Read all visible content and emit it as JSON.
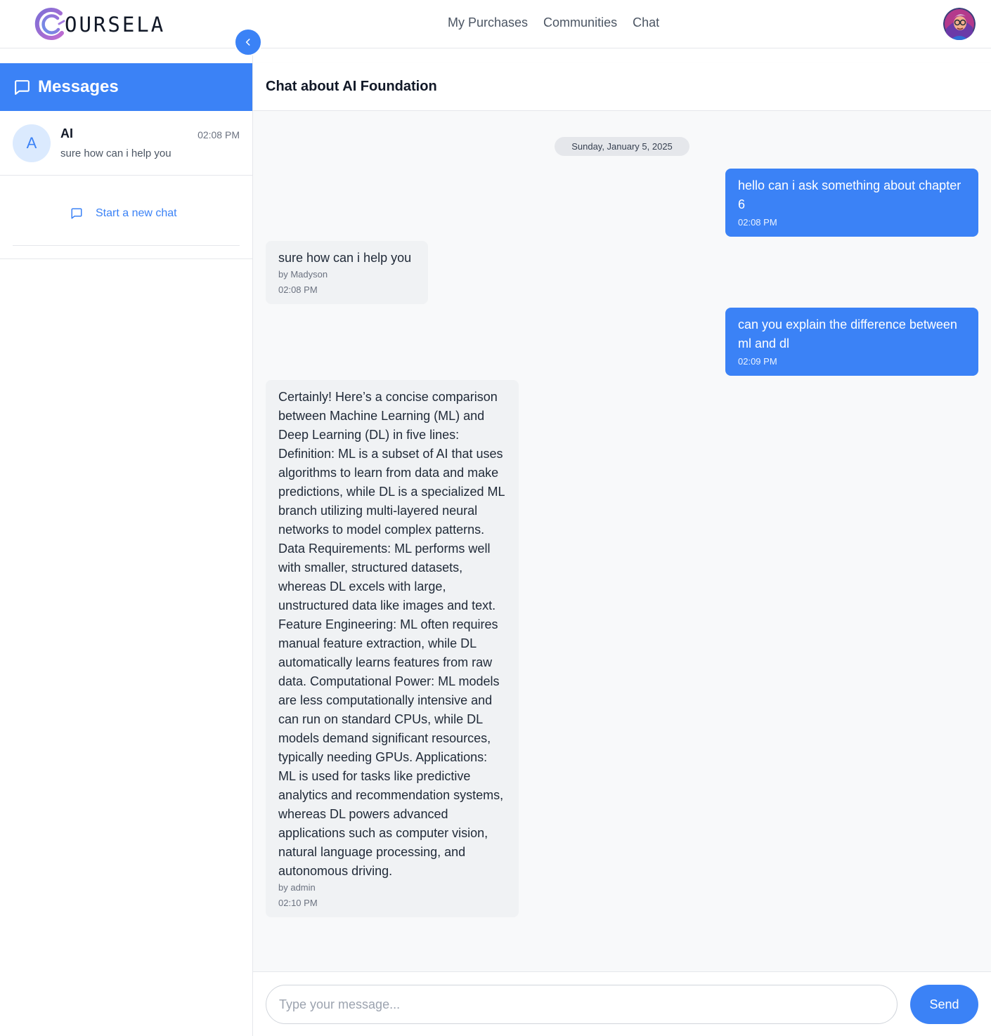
{
  "brand": {
    "name": "OURSELA"
  },
  "nav": {
    "links": [
      {
        "label": "My Purchases"
      },
      {
        "label": "Communities"
      },
      {
        "label": "Chat"
      }
    ]
  },
  "sidebar": {
    "title": "Messages",
    "conversations": [
      {
        "avatar_letter": "A",
        "name": "AI",
        "time": "02:08 PM",
        "preview": "sure how can i help you"
      }
    ],
    "new_chat_label": "Start a new chat"
  },
  "chat": {
    "title": "Chat about AI Foundation",
    "date_divider": "Sunday, January 5, 2025",
    "messages": [
      {
        "direction": "outgoing",
        "text": "hello can i ask something about chapter 6",
        "time": "02:08 PM"
      },
      {
        "direction": "incoming",
        "text": "sure how can i help you",
        "author": "by Madyson",
        "time": "02:08 PM"
      },
      {
        "direction": "outgoing",
        "text": "can you explain the difference between ml and dl",
        "time": "02:09 PM"
      },
      {
        "direction": "incoming",
        "text": "Certainly! Here’s a concise comparison between Machine Learning (ML) and Deep Learning (DL) in five lines: Definition: ML is a subset of AI that uses algorithms to learn from data and make predictions, while DL is a specialized ML branch utilizing multi-layered neural networks to model complex patterns. Data Requirements: ML performs well with smaller, structured datasets, whereas DL excels with large, unstructured data like images and text. Feature Engineering: ML often requires manual feature extraction, while DL automatically learns features from raw data. Computational Power: ML models are less computationally intensive and can run on standard CPUs, while DL models demand significant resources, typically needing GPUs. Applications: ML is used for tasks like predictive analytics and recommendation systems, whereas DL powers advanced applications such as computer vision, natural language processing, and autonomous driving.",
        "author": "by admin",
        "time": "02:10 PM"
      }
    ]
  },
  "composer": {
    "placeholder": "Type your message...",
    "value": "",
    "send_label": "Send"
  },
  "colors": {
    "accent": "#3b82f6",
    "incoming_bubble": "#f0f2f4",
    "chat_background": "#f8f9fa"
  },
  "icons": {
    "logo": "coursela-c-logo-icon",
    "messages": "message-square-icon",
    "collapse": "chevron-left-icon",
    "new_chat": "message-square-icon",
    "profile": "user-avatar"
  }
}
